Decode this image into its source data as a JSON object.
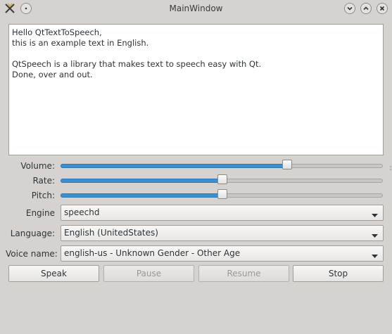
{
  "window": {
    "title": "MainWindow"
  },
  "editor": {
    "lines": [
      "Hello QtTextToSpeech,",
      "this is an example text in English.",
      "",
      "QtSpeech is a library that makes text to speech easy with Qt.",
      "Done, over and out."
    ]
  },
  "controls": {
    "volume": {
      "label": "Volume:",
      "level": 0.7
    },
    "rate": {
      "label": "Rate:",
      "level": 0.5
    },
    "pitch": {
      "label": "Pitch:",
      "level": 0.5
    }
  },
  "combos": {
    "engine": {
      "label": "Engine",
      "value": "speechd"
    },
    "language": {
      "label": "Language:",
      "value": "English (UnitedStates)"
    },
    "voice": {
      "label": "Voice name:",
      "value": "english-us - Unknown Gender - Other Age"
    }
  },
  "buttons": {
    "speak": "Speak",
    "pause": "Pause",
    "resume": "Resume",
    "stop": "Stop"
  },
  "colors": {
    "accent": "#3c8fd0",
    "window_bg": "#d6d2d0"
  }
}
